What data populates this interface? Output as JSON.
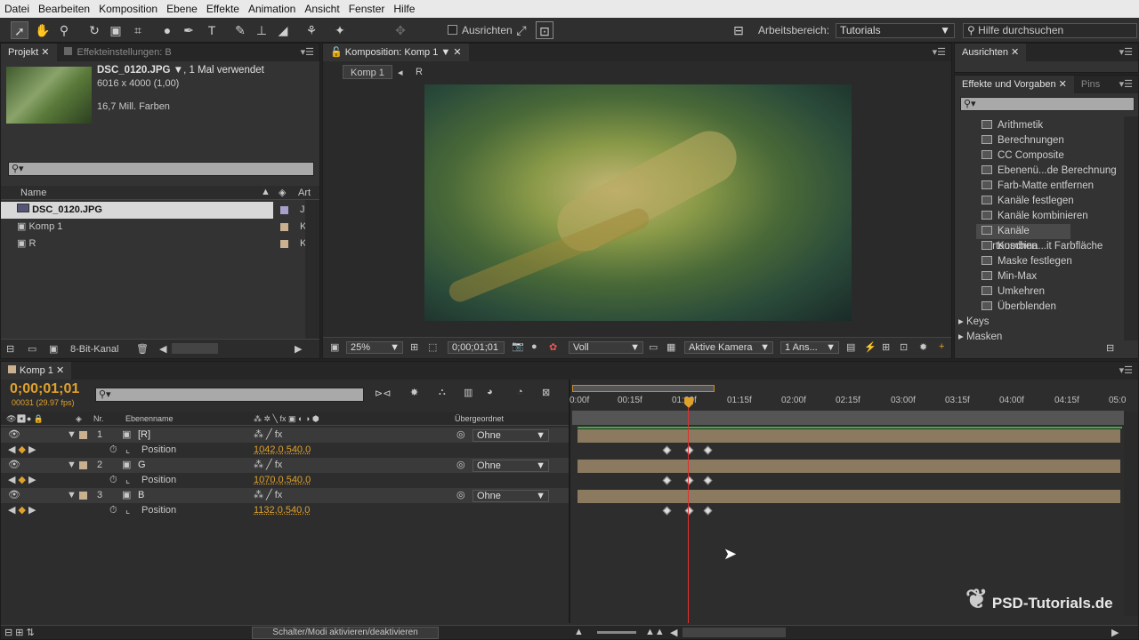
{
  "menu": [
    "Datei",
    "Bearbeiten",
    "Komposition",
    "Ebene",
    "Effekte",
    "Animation",
    "Ansicht",
    "Fenster",
    "Hilfe"
  ],
  "toolbar": {
    "align_label": "Ausrichten",
    "workspace_label": "Arbeitsbereich:",
    "workspace_value": "Tutorials",
    "help_placeholder": "Hilfe durchsuchen"
  },
  "project": {
    "tab1": "Projekt",
    "tab2": "Effekteinstellungen: B",
    "file_name": "DSC_0120.JPG",
    "used": ", 1 Mal verwendet",
    "dims": "6016 x 4000 (1,00)",
    "colors": "16,7 Mill. Farben",
    "col_name": "Name",
    "col_type": "Art",
    "items": [
      {
        "name": "DSC_0120.JPG",
        "type": "J",
        "color": "#a8a0c8"
      },
      {
        "name": "Komp 1",
        "type": "K",
        "color": "#c8b090"
      },
      {
        "name": "R",
        "type": "K",
        "color": "#c8b090"
      }
    ],
    "bitdepth": "8-Bit-Kanal"
  },
  "comp": {
    "tab": "Komposition: Komp 1",
    "crumb1": "Komp 1",
    "crumb2": "R",
    "zoom": "25%",
    "time": "0;00;01;01",
    "quality": "Voll",
    "camera": "Aktive Kamera",
    "views": "1 Ans..."
  },
  "right": {
    "tab1": "Ausrichten",
    "tab2": "Effekte und Vorgaben",
    "tab3": "Pins",
    "effects": [
      "Arithmetik",
      "Berechnungen",
      "CC Composite",
      "Ebenenü...de Berechnung",
      "Farb-Matte entfernen",
      "Kanäle festlegen",
      "Kanäle kombinieren",
      "Kanäle vertauschen",
      "Kombina...it Farbfläche",
      "Maske festlegen",
      "Min-Max",
      "Umkehren",
      "Überblenden"
    ],
    "selected": "Kanäle vertauschen",
    "groups": [
      "Keys",
      "Masken"
    ]
  },
  "timeline": {
    "tab": "Komp 1",
    "timecode": "0;00;01;01",
    "frames": "00031 (29.97 fps)",
    "col_nr": "Nr.",
    "col_name": "Ebenenname",
    "col_parent": "Übergeordnet",
    "ruler": [
      "0:00f",
      "00:15f",
      "01:00f",
      "01:15f",
      "02:00f",
      "02:15f",
      "03:00f",
      "03:15f",
      "04:00f",
      "04:15f",
      "05:0"
    ],
    "layers": [
      {
        "nr": "1",
        "name": "[R]",
        "color": "#c8b090",
        "prop": "Position",
        "value": "1042,0,540,0",
        "parent": "Ohne"
      },
      {
        "nr": "2",
        "name": "G",
        "color": "#c8b090",
        "prop": "Position",
        "value": "1070,0,540,0",
        "parent": "Ohne"
      },
      {
        "nr": "3",
        "name": "B",
        "color": "#c8b090",
        "prop": "Position",
        "value": "1132,0,540,0",
        "parent": "Ohne"
      }
    ],
    "toggle_label": "Schalter/Modi aktivieren/deaktivieren"
  },
  "watermark": "PSD-Tutorials.de"
}
